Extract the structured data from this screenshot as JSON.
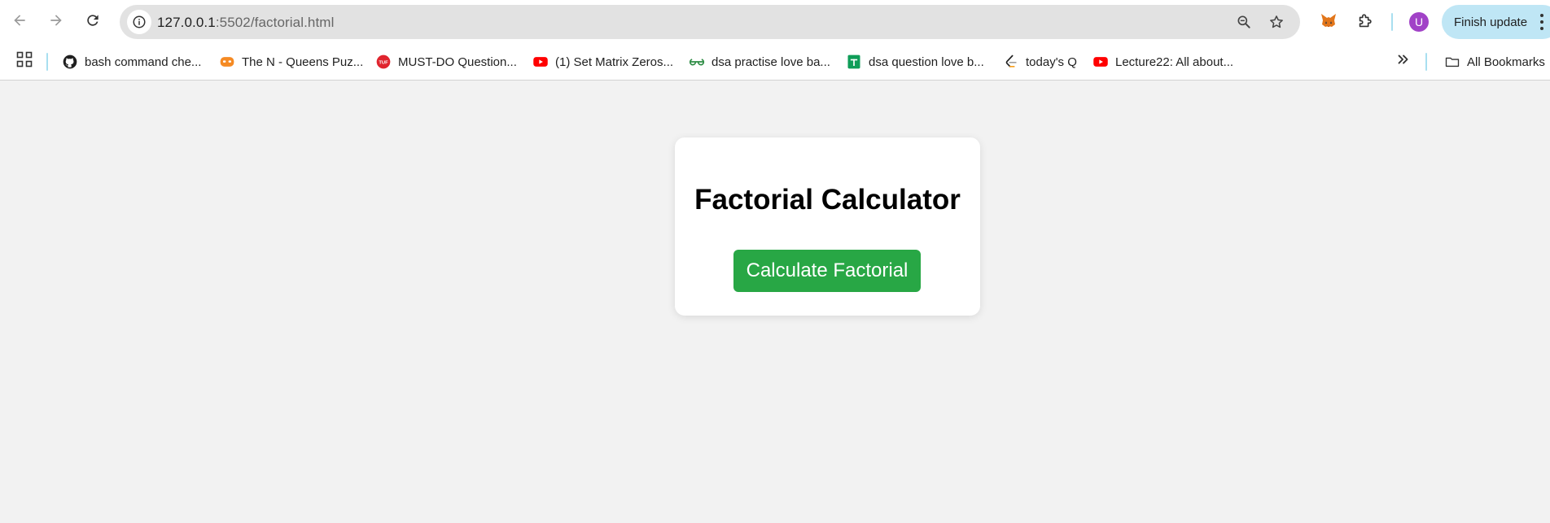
{
  "browser": {
    "url_host": "127.0.0.1",
    "url_path": ":5502/factorial.html",
    "profile_initial": "U",
    "finish_update_label": "Finish update",
    "accent_color": "#bfe6f5"
  },
  "bookmarks": {
    "items": [
      {
        "label": "bash command che...",
        "icon": "github-icon"
      },
      {
        "label": "The N - Queens Puz...",
        "icon": "codingninjas-icon"
      },
      {
        "label": "MUST-DO Question...",
        "icon": "tuf-icon"
      },
      {
        "label": "(1) Set Matrix Zeros...",
        "icon": "youtube-icon"
      },
      {
        "label": "dsa practise love ba...",
        "icon": "geeksforgeeks-icon"
      },
      {
        "label": "dsa question love b...",
        "icon": "google-sheets-icon"
      },
      {
        "label": "today's Q",
        "icon": "leetcode-icon"
      },
      {
        "label": "Lecture22: All about...",
        "icon": "youtube-icon"
      }
    ],
    "all_bookmarks_label": "All Bookmarks"
  },
  "page": {
    "title": "Factorial Calculator",
    "button_label": "Calculate Factorial",
    "button_color": "#28a745",
    "background_color": "#f2f2f2"
  }
}
